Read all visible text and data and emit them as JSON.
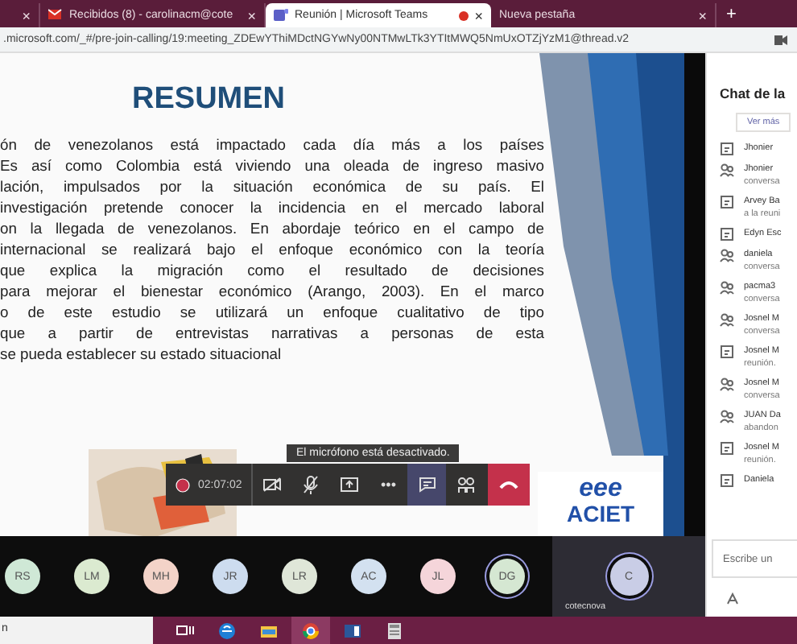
{
  "browser": {
    "tabs": [
      {
        "kind": "partial",
        "selected": false,
        "recording": false
      },
      {
        "kind": "mail",
        "label": "Recibidos (8) - carolinacm@cote",
        "selected": false,
        "recording": false
      },
      {
        "kind": "teams",
        "label": "Reunión | Microsoft Teams",
        "selected": true,
        "recording": true
      },
      {
        "kind": "blank",
        "label": "Nueva pestaña",
        "selected": false,
        "recording": false
      }
    ],
    "close_glyph": "×",
    "new_tab": "+",
    "address": ".microsoft.com/_#/pre-join-calling/19:meeting_ZDEwYThiMDctNGYwNy00NTMwLTk3YTItMWQ5NmUxOTZjYzM1@thread.v2"
  },
  "slide": {
    "title": "RESUMEN",
    "lines": [
      "ón de venezolanos está impactado cada día más a los países",
      "Es así como Colombia está viviendo una oleada de ingreso masivo",
      "lación, impulsados por la situación económica de su país. El",
      "investigación pretende conocer la incidencia en el mercado laboral",
      "on la llegada de venezolanos. En abordaje teórico en el campo de",
      "internacional se realizará bajo el enfoque económico con la teoría",
      "que explica la migración como el resultado de decisiones",
      "para mejorar el bienestar económico (Arango, 2003). En el marco",
      "o de este estudio se utilizará un enfoque cualitativo de tipo",
      "que a partir de entrevistas narrativas a personas de esta",
      "se pueda establecer su estado situacional"
    ],
    "logo": {
      "mark": "eee",
      "name": "ACIET"
    }
  },
  "call": {
    "tooltip": "El micrófono está desactivado.",
    "timer": "02:07:02",
    "more": "•••",
    "chat_selected": true
  },
  "participants": [
    {
      "initials": "RS",
      "color": "#cfe8d6",
      "ring": false
    },
    {
      "initials": "LM",
      "color": "#dbead0",
      "ring": false
    },
    {
      "initials": "MH",
      "color": "#f3d3c8",
      "ring": false
    },
    {
      "initials": "JR",
      "color": "#cddcef",
      "ring": false
    },
    {
      "initials": "LR",
      "color": "#dfe6d8",
      "ring": false
    },
    {
      "initials": "AC",
      "color": "#d3e1f0",
      "ring": false
    },
    {
      "initials": "JL",
      "color": "#f5d5da",
      "ring": false
    },
    {
      "initials": "DG",
      "color": "#d5e7d2",
      "ring": true
    }
  ],
  "self": {
    "initials": "C",
    "label": "cotecnova"
  },
  "chat": {
    "title": "Chat de la",
    "more_button": "Ver más",
    "input_placeholder": "Escribe un",
    "messages": [
      {
        "kind": "meeting",
        "lines": [
          "Jhonier"
        ]
      },
      {
        "kind": "person",
        "lines": [
          "Jhonier",
          "conversa"
        ]
      },
      {
        "kind": "meeting",
        "lines": [
          "Arvey Ba",
          "a la reuni"
        ]
      },
      {
        "kind": "meeting",
        "lines": [
          "Edyn Esc"
        ]
      },
      {
        "kind": "person",
        "lines": [
          "daniela",
          "conversa"
        ]
      },
      {
        "kind": "person",
        "lines": [
          "pacma3",
          "conversa"
        ]
      },
      {
        "kind": "person",
        "lines": [
          "Josnel M",
          "conversa"
        ]
      },
      {
        "kind": "meeting",
        "lines": [
          "Josnel M",
          "reunión."
        ]
      },
      {
        "kind": "person",
        "lines": [
          "Josnel M",
          "conversa"
        ]
      },
      {
        "kind": "person",
        "lines": [
          "JUAN Da",
          "abandon"
        ]
      },
      {
        "kind": "meeting",
        "lines": [
          "Josnel M",
          "reunión."
        ]
      },
      {
        "kind": "meeting",
        "lines": [
          "Daniela"
        ]
      }
    ]
  },
  "taskbar": {
    "search_text": "n",
    "apps": [
      {
        "kind": "taskview",
        "active": false
      },
      {
        "kind": "edge",
        "active": false
      },
      {
        "kind": "files",
        "active": false
      },
      {
        "kind": "chrome",
        "active": true
      },
      {
        "kind": "word",
        "active": false
      },
      {
        "kind": "calculator",
        "active": false
      }
    ]
  }
}
